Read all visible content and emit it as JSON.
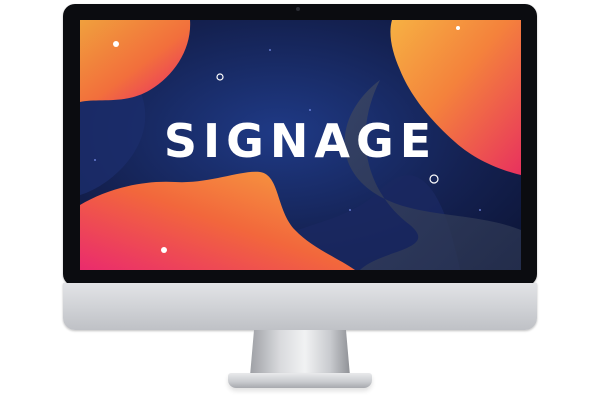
{
  "screen": {
    "headline": "SIGNAGE"
  },
  "colors": {
    "background_dark": "#142151",
    "gradient_orange": "#f7a340",
    "gradient_pink": "#e9266a",
    "text": "#ffffff",
    "bezel": "#0b0c10",
    "aluminum": "#cfd1d5"
  }
}
